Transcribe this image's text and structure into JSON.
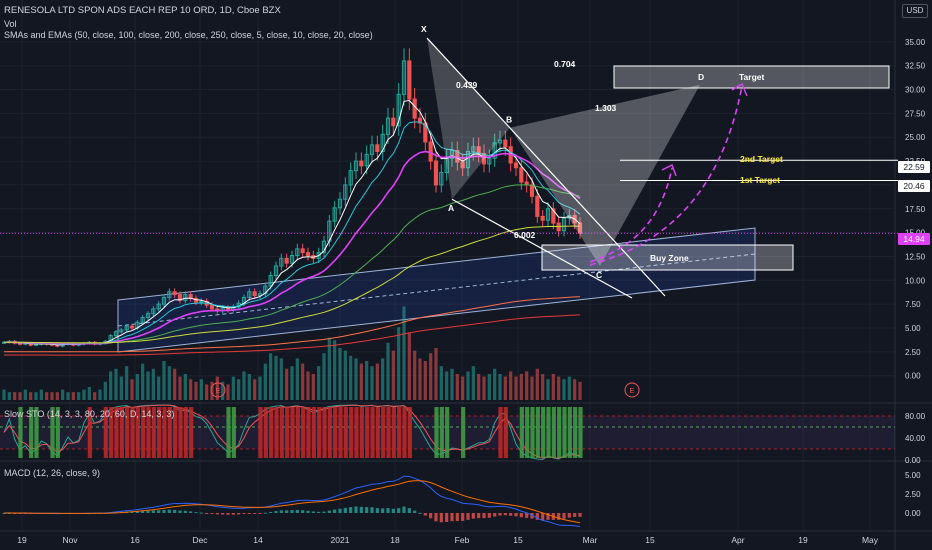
{
  "legend": {
    "title": "RENESOLA LTD SPON ADS EACH REP 10 ORD, 1D, Cboe BZX",
    "vol": "Vol",
    "mas": "SMAs and EMAs (50, close, 100, close, 200, close, 250, close, 5, close, 10, close, 20, close)",
    "sto": "Slow STO (14, 3, 3, 80, 20, 60, D, 14, 3, 3)",
    "macd": "MACD (12, 26, close, 9)"
  },
  "currency": "USD",
  "price_badges": {
    "current": "14.94",
    "second_target": "22.59",
    "first_target": "20.46"
  },
  "annotations": {
    "x": "X",
    "a": "A",
    "b": "B",
    "c": "C",
    "d": "D",
    "r1": "0.439",
    "r2": "0.704",
    "r3": "1.303",
    "r4": "0.002",
    "target": "Target",
    "second_target": "2nd Target",
    "first_target": "1st Target",
    "buy_zone": "Buy Zone",
    "earnings": "E"
  },
  "colors": {
    "bg": "#131722",
    "up": "#26a69a",
    "down": "#ef5350",
    "magenta": "#e040fb",
    "grid": "#1e222d"
  },
  "chart_data": {
    "type": "candlestick",
    "title": "RENESOLA LTD SPON ADS EACH REP 10 ORD, 1D, Cboe BZX",
    "price_axis": {
      "ticks": [
        "35.00",
        "32.50",
        "30.00",
        "27.50",
        "25.00",
        "22.50",
        "20.00",
        "17.50",
        "15.00",
        "12.50",
        "10.00",
        "7.50",
        "5.00",
        "2.50",
        "0.00"
      ],
      "range": [
        -1.5,
        37.5
      ]
    },
    "time_axis": {
      "ticks": [
        "19",
        "Nov",
        "16",
        "Dec",
        "14",
        "2021",
        "18",
        "Feb",
        "15",
        "Mar",
        "15",
        "Apr",
        "19",
        "May"
      ]
    },
    "sto_axis": {
      "ticks": [
        "80.00",
        "40.00",
        "0.00"
      ]
    },
    "macd_axis": {
      "ticks": [
        "5.00",
        "2.50",
        "0.00"
      ]
    },
    "last_price": 14.94,
    "levels": [
      {
        "label": "2nd Target",
        "value": 22.59
      },
      {
        "label": "1st Target",
        "value": 20.46
      }
    ],
    "pattern_points": [
      {
        "label": "X",
        "value": 35.4
      },
      {
        "label": "A",
        "value": 18.5
      },
      {
        "label": "B",
        "value": 26.0
      },
      {
        "label": "C",
        "value": 11.5
      },
      {
        "label": "D",
        "value": 30.5
      }
    ],
    "ratios": [
      "0.439",
      "0.704",
      "1.303",
      "0.002"
    ],
    "close_series": [
      3.5,
      3.6,
      3.4,
      3.3,
      3.4,
      3.2,
      3.3,
      3.4,
      3.3,
      3.2,
      3.1,
      3.3,
      3.4,
      3.2,
      3.3,
      3.4,
      3.5,
      3.3,
      3.4,
      3.6,
      4.2,
      4.6,
      4.8,
      5.2,
      5.0,
      5.6,
      6.1,
      6.5,
      7.0,
      7.5,
      8.2,
      8.8,
      8.5,
      7.9,
      8.5,
      8.1,
      7.7,
      7.8,
      7.4,
      7.0,
      6.8,
      7.1,
      6.9,
      7.2,
      7.6,
      8.2,
      8.8,
      8.4,
      8.6,
      9.4,
      10.5,
      11.5,
      12.3,
      11.8,
      12.6,
      13.3,
      12.9,
      12.6,
      12.3,
      12.9,
      14.1,
      16.2,
      17.6,
      18.5,
      20.0,
      21.5,
      22.5,
      22.0,
      23.2,
      24.2,
      23.5,
      25.3,
      27.0,
      26.2,
      29.5,
      33.0,
      29.0,
      27.0,
      26.5,
      24.5,
      22.5,
      20.0,
      21.3,
      22.8,
      23.6,
      22.4,
      21.8,
      23.5,
      24.0,
      23.3,
      22.2,
      22.8,
      24.4,
      24.7,
      24.0,
      22.3,
      21.8,
      20.3,
      20.0,
      18.8,
      16.7,
      16.3,
      17.5,
      16.0,
      15.2,
      16.5,
      16.8,
      16.0,
      14.94
    ],
    "volume": [
      0.4,
      0.3,
      0.3,
      0.3,
      0.4,
      0.3,
      0.3,
      0.4,
      0.3,
      0.3,
      0.3,
      0.4,
      0.3,
      0.3,
      0.3,
      0.4,
      0.5,
      0.3,
      0.4,
      0.7,
      1.1,
      1.2,
      0.9,
      1.3,
      0.8,
      1.0,
      1.4,
      1.1,
      1.2,
      0.9,
      1.5,
      1.3,
      1.2,
      0.9,
      1.0,
      0.8,
      0.7,
      0.8,
      0.6,
      0.7,
      0.9,
      0.7,
      0.6,
      0.9,
      0.8,
      1.1,
      1.0,
      0.8,
      0.9,
      1.4,
      1.8,
      1.7,
      1.6,
      1.2,
      1.3,
      1.6,
      1.4,
      1.1,
      1.0,
      1.3,
      1.8,
      2.4,
      2.3,
      2.0,
      1.9,
      1.7,
      1.6,
      1.4,
      1.5,
      1.3,
      1.4,
      1.6,
      2.2,
      1.9,
      2.8,
      3.6,
      2.6,
      1.9,
      1.6,
      1.5,
      1.8,
      2.0,
      1.3,
      1.1,
      1.2,
      1.0,
      0.9,
      1.1,
      1.3,
      1.0,
      0.9,
      1.0,
      1.2,
      1.0,
      0.9,
      1.1,
      0.9,
      1.0,
      1.1,
      0.9,
      1.2,
      1.0,
      0.8,
      1.0,
      0.9,
      0.8,
      0.9,
      0.8,
      0.7
    ]
  }
}
